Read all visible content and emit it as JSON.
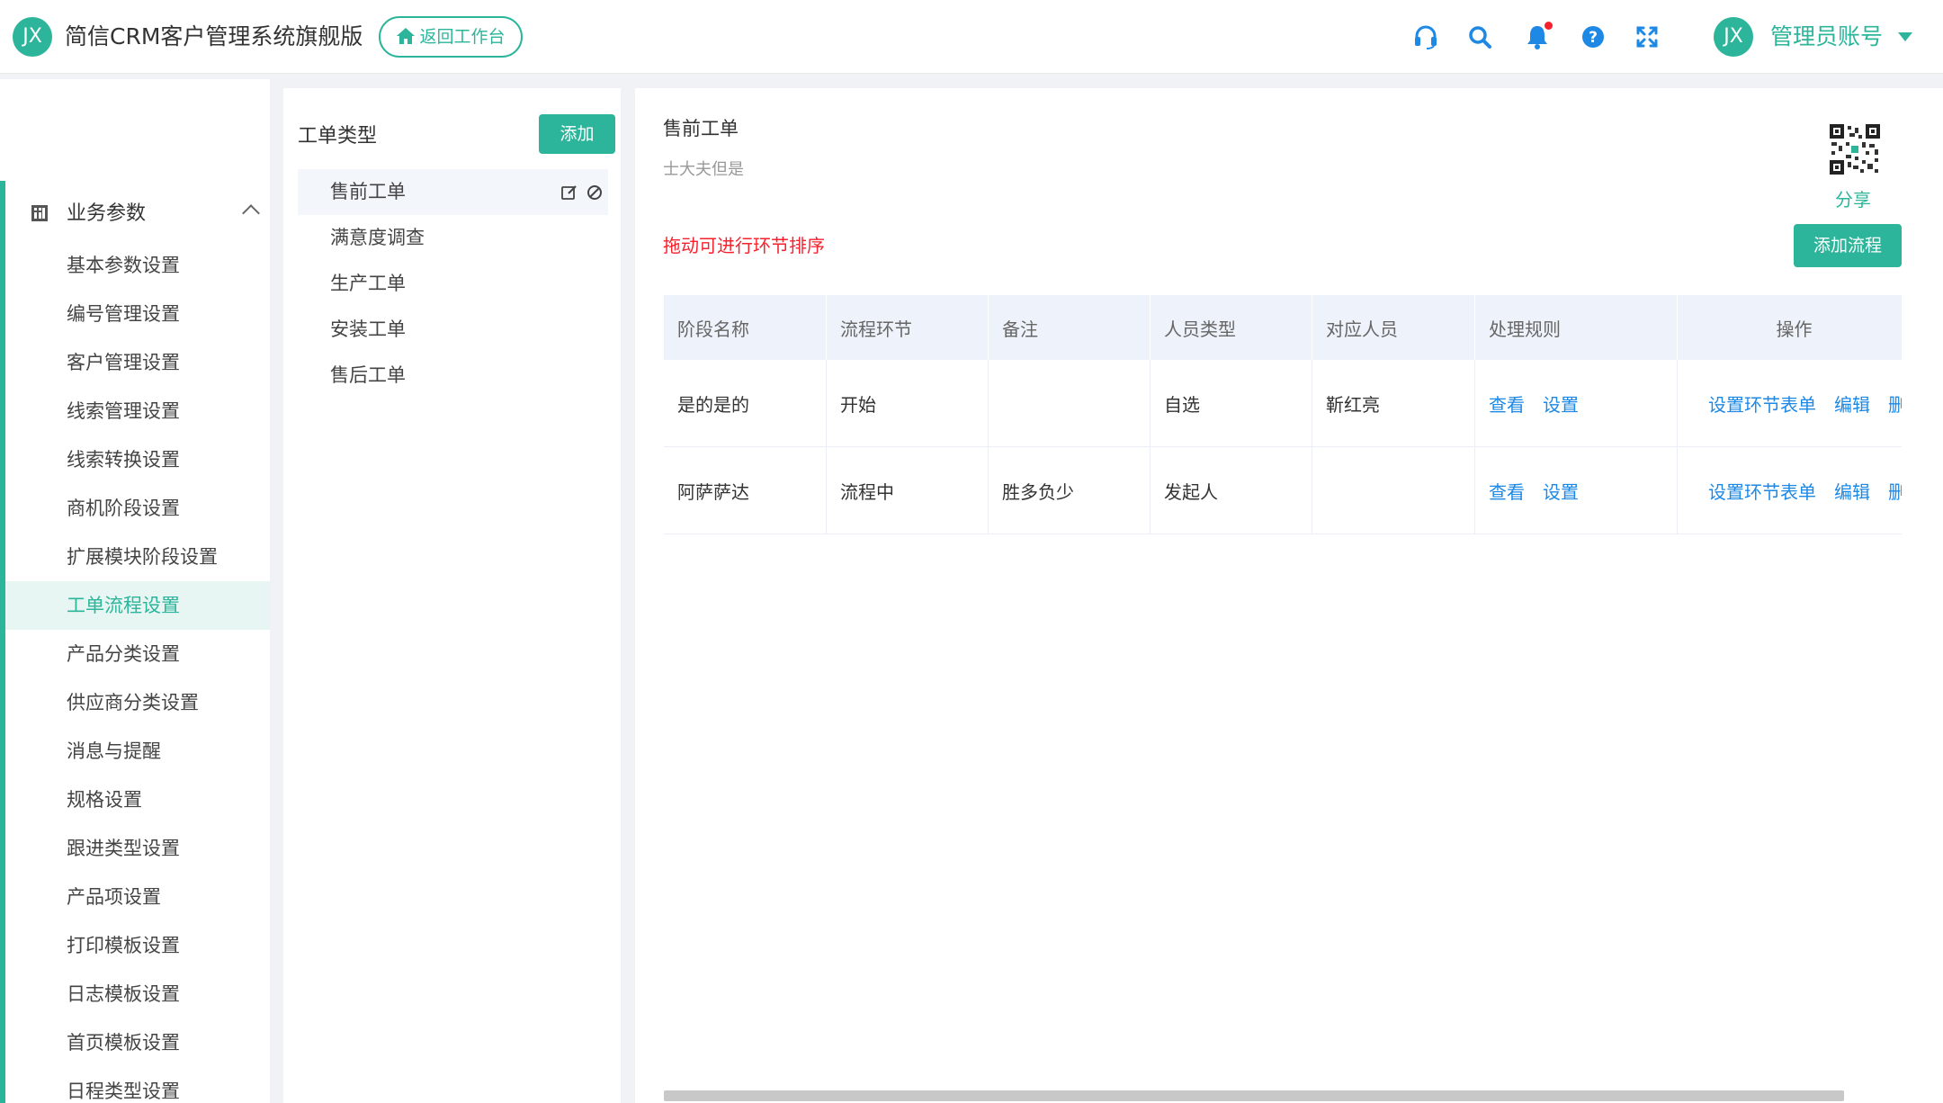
{
  "header": {
    "logo_text": "JX",
    "app_title": "简信CRM客户管理系统旗舰版",
    "back_button": "返回工作台",
    "icons": [
      "headset-icon",
      "search-icon",
      "bell-icon",
      "help-icon",
      "fullscreen-icon"
    ],
    "avatar_text": "JX",
    "user_name": "管理员账号",
    "accent_color": "#2cb59a",
    "icon_color": "#1e88e5"
  },
  "sidebar": {
    "group_label": "业务参数",
    "items": [
      {
        "label": "基本参数设置"
      },
      {
        "label": "编号管理设置"
      },
      {
        "label": "客户管理设置"
      },
      {
        "label": "线索管理设置"
      },
      {
        "label": "线索转换设置"
      },
      {
        "label": "商机阶段设置"
      },
      {
        "label": "扩展模块阶段设置"
      },
      {
        "label": "工单流程设置"
      },
      {
        "label": "产品分类设置"
      },
      {
        "label": "供应商分类设置"
      },
      {
        "label": "消息与提醒"
      },
      {
        "label": "规格设置"
      },
      {
        "label": "跟进类型设置"
      },
      {
        "label": "产品项设置"
      },
      {
        "label": "打印模板设置"
      },
      {
        "label": "日志模板设置"
      },
      {
        "label": "首页模板设置"
      },
      {
        "label": "日程类型设置"
      }
    ],
    "active_index": 7
  },
  "types_panel": {
    "title": "工单类型",
    "add_button": "添加",
    "items": [
      {
        "label": "售前工单"
      },
      {
        "label": "满意度调查"
      },
      {
        "label": "生产工单"
      },
      {
        "label": "安装工单"
      },
      {
        "label": "售后工单"
      }
    ],
    "active_index": 0
  },
  "main": {
    "title": "售前工单",
    "subtitle": "士大夫但是",
    "share_label": "分享",
    "drag_hint": "拖动可进行环节排序",
    "add_flow_button": "添加流程",
    "table": {
      "headers": [
        "阶段名称",
        "流程环节",
        "备注",
        "人员类型",
        "对应人员",
        "处理规则",
        "操作"
      ],
      "rows": [
        {
          "stage": "是的是的",
          "step": "开始",
          "note": "",
          "person_type": "自选",
          "person": "靳红亮",
          "rule_view": "查看",
          "rule_set": "设置",
          "op_form": "设置环节表单",
          "op_edit": "编辑",
          "op_delete": "删"
        },
        {
          "stage": "阿萨萨达",
          "step": "流程中",
          "note": "胜多负少",
          "person_type": "发起人",
          "person": "",
          "rule_view": "查看",
          "rule_set": "设置",
          "op_form": "设置环节表单",
          "op_edit": "编辑",
          "op_delete": "删"
        }
      ]
    }
  }
}
